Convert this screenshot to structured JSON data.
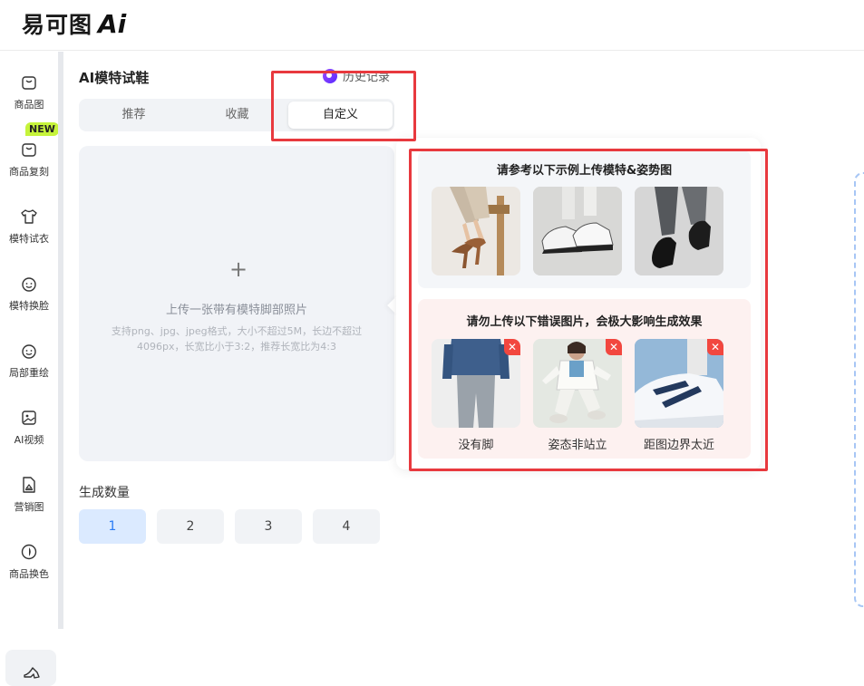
{
  "header": {
    "logo_text": "易可图",
    "logo_ai": "Ai"
  },
  "nav": {
    "badge": "NEW",
    "items": [
      {
        "label": "商品图",
        "icon": "bag-icon"
      },
      {
        "label": "商品复刻",
        "icon": "bag-copy-icon"
      },
      {
        "label": "模特试衣",
        "icon": "tshirt-icon"
      },
      {
        "label": "模特换脸",
        "icon": "face-swap-icon"
      },
      {
        "label": "局部重绘",
        "icon": "face-redraw-icon"
      },
      {
        "label": "AI视频",
        "icon": "video-icon"
      },
      {
        "label": "营销图",
        "icon": "marketing-icon"
      },
      {
        "label": "商品换色",
        "icon": "color-drop-icon"
      }
    ]
  },
  "panel": {
    "title": "AI模特试鞋",
    "history": "历史记录",
    "tabs": [
      "推荐",
      "收藏",
      "自定义"
    ],
    "upload": {
      "plus": "+",
      "main": "上传一张带有模特脚部照片",
      "sub": "支持png、jpg、jpeg格式，大小不超过5M，长边不超过4096px，长宽比小于3:2，推荐长宽比为4:3"
    },
    "generate_label": "生成数量",
    "quantities": [
      "1",
      "2",
      "3",
      "4"
    ]
  },
  "popover": {
    "good_title": "请参考以下示例上传模特&姿势图",
    "bad_title": "请勿上传以下错误图片，会极大影响生成效果",
    "bad_labels": [
      "没有脚",
      "姿态非站立",
      "距图边界太近"
    ],
    "close_glyph": "✕"
  }
}
